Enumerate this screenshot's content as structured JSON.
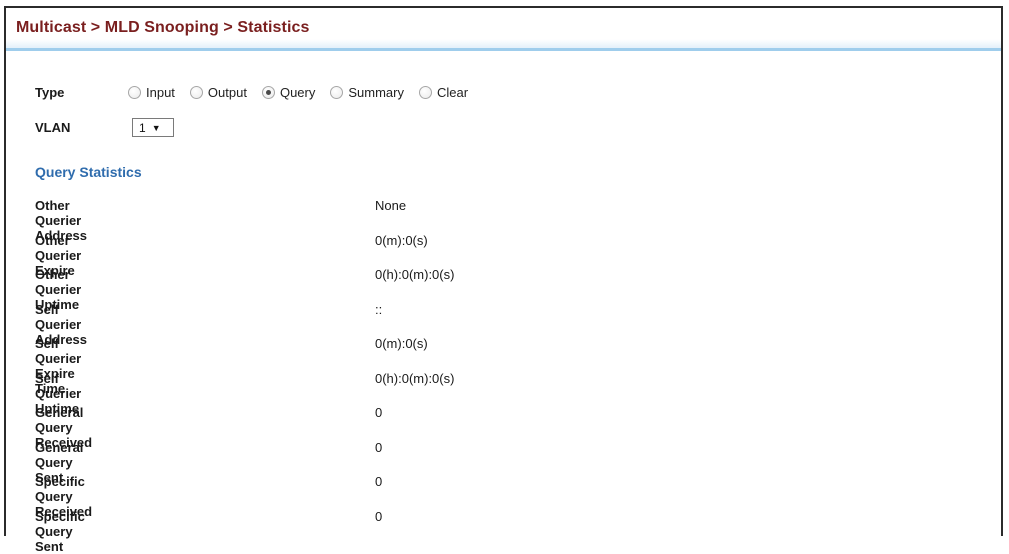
{
  "header": {
    "breadcrumb": "Multicast > MLD Snooping > Statistics"
  },
  "form": {
    "type_label": "Type",
    "type_options": [
      {
        "label": "Input",
        "checked": false
      },
      {
        "label": "Output",
        "checked": false
      },
      {
        "label": "Query",
        "checked": true
      },
      {
        "label": "Summary",
        "checked": false
      },
      {
        "label": "Clear",
        "checked": false
      }
    ],
    "vlan_label": "VLAN",
    "vlan_value": "1",
    "vlan_arrow": "▼"
  },
  "section": {
    "title": "Query Statistics"
  },
  "stats": [
    {
      "label": "Other Querier Address",
      "value": "None"
    },
    {
      "label": "Other Querier Expire",
      "value": "0(m):0(s)"
    },
    {
      "label": "Other Querier Uptime",
      "value": "0(h):0(m):0(s)"
    },
    {
      "label": "Self Querier Address",
      "value": "::"
    },
    {
      "label": "Self Querier Expire Time",
      "value": "0(m):0(s)"
    },
    {
      "label": "Self Querier Uptime",
      "value": "0(h):0(m):0(s)"
    },
    {
      "label": "General Query Received",
      "value": "0"
    },
    {
      "label": "General Query Sent",
      "value": "0"
    },
    {
      "label": "Specific Query Received",
      "value": "0"
    },
    {
      "label": "Specific Query Sent",
      "value": "0"
    }
  ],
  "colors": {
    "title": "#7a1f1f",
    "section_title": "#2f6cad",
    "header_rule": "#9fcdec"
  }
}
